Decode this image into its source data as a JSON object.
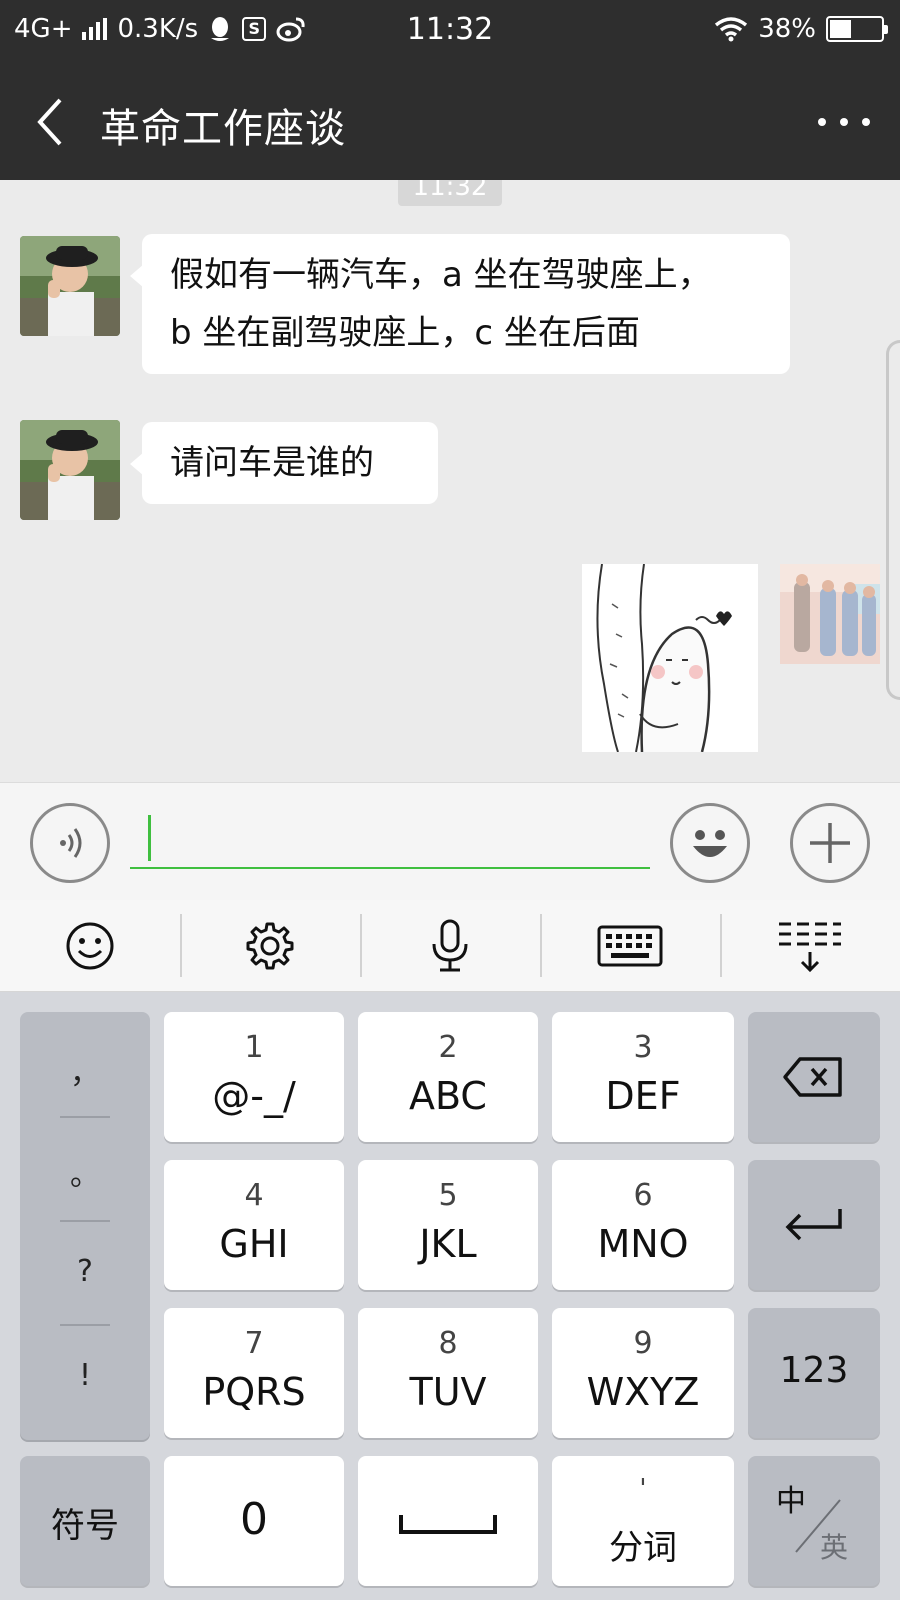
{
  "status_bar": {
    "network": "4G+",
    "speed": "0.3K/s",
    "time": "11:32",
    "battery": "38%",
    "battery_level": 0.38,
    "icons": [
      "signal-icon",
      "qq-icon",
      "s-app-icon",
      "weibo-icon",
      "wifi-icon",
      "battery-icon"
    ]
  },
  "header": {
    "title": "革命工作座谈",
    "back_icon": "chevron-left-icon",
    "more_icon": "more-dots-icon"
  },
  "chat": {
    "time_chip": "11:32",
    "messages": [
      {
        "sender": "other",
        "lines": [
          "假如有一辆汽车，a 坐在驾驶座上，",
          "b 坐在副驾驶座上，c 坐在后面"
        ]
      },
      {
        "sender": "other",
        "lines": [
          "请问车是谁的"
        ]
      },
      {
        "sender": "self",
        "type": "sticker"
      }
    ]
  },
  "input_bar": {
    "voice_icon": "voice-icon",
    "emoji_icon": "emoji-icon",
    "plus_icon": "plus-icon",
    "value": ""
  },
  "keyboard_toolbar": {
    "items": [
      "smiley-icon",
      "settings-icon",
      "microphone-icon",
      "keyboard-icon",
      "collapse-keyboard-icon"
    ]
  },
  "keyboard": {
    "punctuation": [
      "，",
      "。",
      "?",
      "!"
    ],
    "keys": [
      {
        "num": "1",
        "letters": "@-_/"
      },
      {
        "num": "2",
        "letters": "ABC"
      },
      {
        "num": "3",
        "letters": "DEF"
      },
      {
        "num": "4",
        "letters": "GHI"
      },
      {
        "num": "5",
        "letters": "JKL"
      },
      {
        "num": "6",
        "letters": "MNO"
      },
      {
        "num": "7",
        "letters": "PQRS"
      },
      {
        "num": "8",
        "letters": "TUV"
      },
      {
        "num": "9",
        "letters": "WXYZ"
      }
    ],
    "symbols": "符号",
    "zero": "0",
    "segment_mark": "'",
    "segment": "分词",
    "num_mode": "123",
    "lang_main": "中",
    "lang_alt": "英",
    "backspace_icon": "backspace-icon",
    "enter_icon": "enter-icon",
    "space_icon": "space-icon"
  }
}
